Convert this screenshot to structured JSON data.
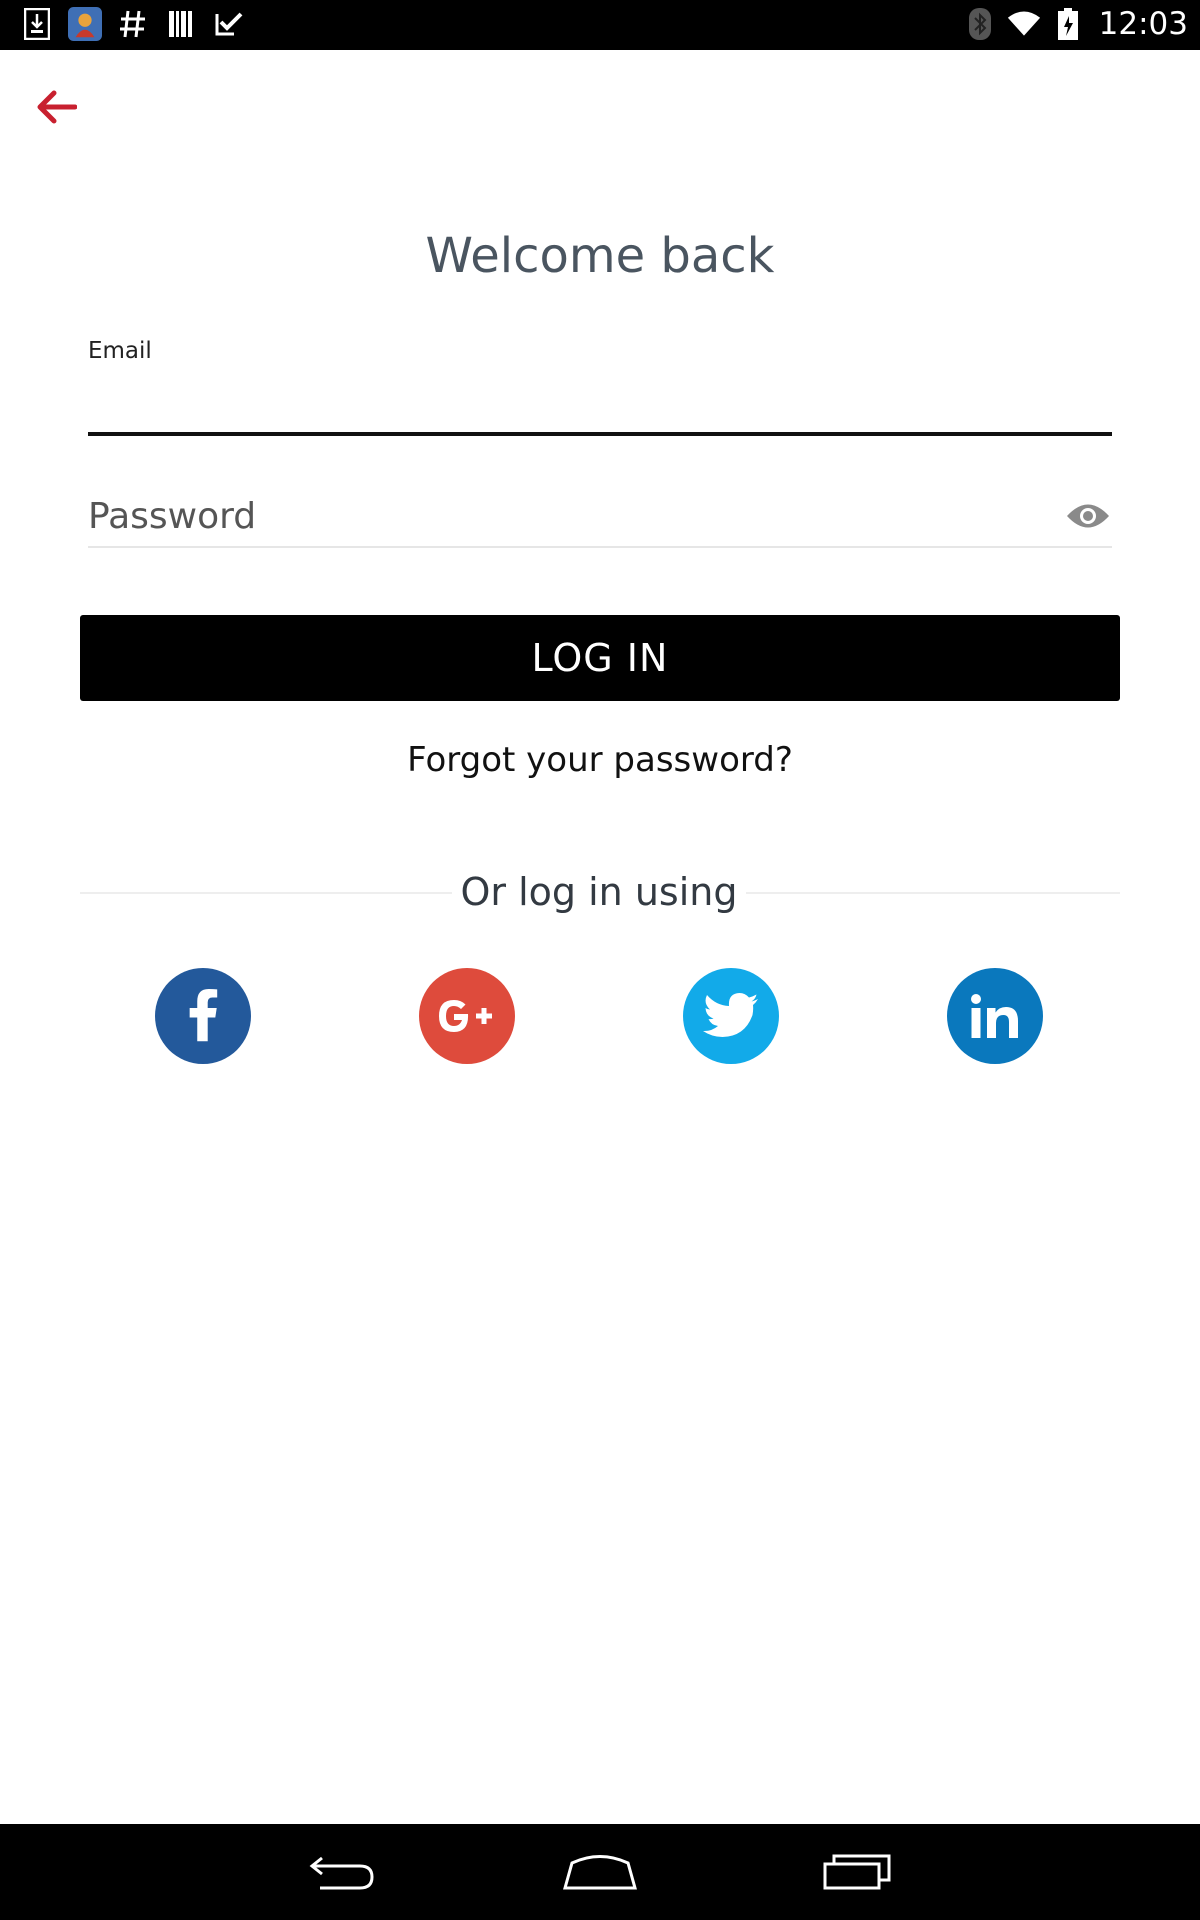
{
  "status_bar": {
    "time": "12:03",
    "left_icons": [
      "download-icon",
      "app-notification-icon",
      "hashtag-icon",
      "barcode-icon",
      "checklist-icon"
    ],
    "right_icons": [
      "bluetooth-icon",
      "wifi-icon",
      "battery-icon"
    ]
  },
  "header": {
    "back_icon": "arrow-left-icon",
    "back_color": "#c8202f"
  },
  "main": {
    "title": "Welcome back",
    "email": {
      "label": "Email",
      "value": ""
    },
    "password": {
      "placeholder": "Password",
      "value": ""
    },
    "login_label": "LOG IN",
    "forgot_label": "Forgot your password?",
    "divider_text": "Or log in using",
    "social": [
      {
        "name": "facebook",
        "icon": "facebook-icon",
        "color": "#23599b"
      },
      {
        "name": "google-plus",
        "icon": "google-plus-icon",
        "color": "#de4b3c"
      },
      {
        "name": "twitter",
        "icon": "twitter-icon",
        "color": "#12aae9"
      },
      {
        "name": "linkedin",
        "icon": "linkedin-icon",
        "color": "#0a78bd"
      }
    ]
  },
  "nav_bar": {
    "buttons": [
      "back-nav-icon",
      "home-nav-icon",
      "recents-nav-icon"
    ]
  }
}
